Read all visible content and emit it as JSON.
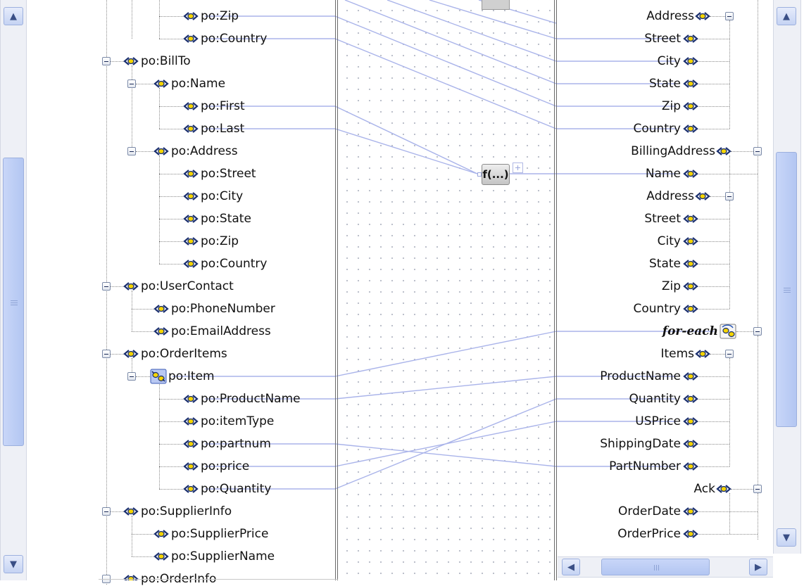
{
  "source_tree": [
    {
      "kind": "elem",
      "label": "po:Zip",
      "link": true
    },
    {
      "kind": "elem",
      "label": "po:Country",
      "link": true
    },
    {
      "kind": "node",
      "label": "po:BillTo",
      "expanded": true
    },
    {
      "kind": "node",
      "label": "po:Name",
      "expanded": true
    },
    {
      "kind": "elem",
      "label": "po:First",
      "link": true
    },
    {
      "kind": "elem",
      "label": "po:Last",
      "link": true
    },
    {
      "kind": "node",
      "label": "po:Address",
      "expanded": true
    },
    {
      "kind": "elem",
      "label": "po:Street",
      "link": false
    },
    {
      "kind": "elem",
      "label": "po:City",
      "link": false
    },
    {
      "kind": "elem",
      "label": "po:State",
      "link": false
    },
    {
      "kind": "elem",
      "label": "po:Zip",
      "link": false
    },
    {
      "kind": "elem",
      "label": "po:Country",
      "link": false
    },
    {
      "kind": "node",
      "label": "po:UserContact",
      "expanded": true
    },
    {
      "kind": "elem",
      "label": "po:PhoneNumber",
      "link": false
    },
    {
      "kind": "elem",
      "label": "po:EmailAddress",
      "link": false
    },
    {
      "kind": "node",
      "label": "po:OrderItems",
      "expanded": true
    },
    {
      "kind": "repeat",
      "label": "po:Item",
      "expanded": true,
      "link": true
    },
    {
      "kind": "elem",
      "label": "po:ProductName",
      "link": true
    },
    {
      "kind": "elem",
      "label": "po:itemType",
      "link": false
    },
    {
      "kind": "elem",
      "label": "po:partnum",
      "link": true
    },
    {
      "kind": "elem",
      "label": "po:price",
      "link": true
    },
    {
      "kind": "elem",
      "label": "po:Quantity",
      "link": true
    },
    {
      "kind": "node",
      "label": "po:SupplierInfo",
      "expanded": true
    },
    {
      "kind": "elem",
      "label": "po:SupplierPrice",
      "link": false
    },
    {
      "kind": "elem",
      "label": "po:SupplierName",
      "link": false
    },
    {
      "kind": "node",
      "label": "po:OrderInfo",
      "expanded": true
    }
  ],
  "target_tree": [
    {
      "kind": "node",
      "label": "Address",
      "link": false
    },
    {
      "kind": "elem",
      "label": "Street",
      "link": true
    },
    {
      "kind": "elem",
      "label": "City",
      "link": true
    },
    {
      "kind": "elem",
      "label": "State",
      "link": true
    },
    {
      "kind": "elem",
      "label": "Zip",
      "link": true
    },
    {
      "kind": "elem",
      "label": "Country",
      "link": true
    },
    {
      "kind": "node",
      "label": "BillingAddress",
      "link": false
    },
    {
      "kind": "elem",
      "label": "Name",
      "link": true
    },
    {
      "kind": "node",
      "label": "Address",
      "link": false
    },
    {
      "kind": "elem",
      "label": "Street",
      "link": false
    },
    {
      "kind": "elem",
      "label": "City",
      "link": false
    },
    {
      "kind": "elem",
      "label": "State",
      "link": false
    },
    {
      "kind": "elem",
      "label": "Zip",
      "link": false
    },
    {
      "kind": "elem",
      "label": "Country",
      "link": false
    },
    {
      "kind": "foreach",
      "label": "for-each",
      "link": true
    },
    {
      "kind": "node",
      "label": "Items",
      "link": false
    },
    {
      "kind": "elem",
      "label": "ProductName",
      "link": true
    },
    {
      "kind": "elem",
      "label": "Quantity",
      "link": true
    },
    {
      "kind": "elem",
      "label": "USPrice",
      "link": true
    },
    {
      "kind": "elem",
      "label": "ShippingDate",
      "link": false
    },
    {
      "kind": "elem",
      "label": "PartNumber",
      "link": true
    },
    {
      "kind": "node",
      "label": "Ack",
      "link": false
    },
    {
      "kind": "elem",
      "label": "OrderDate",
      "link": false
    },
    {
      "kind": "elem",
      "label": "OrderPrice",
      "link": false
    }
  ],
  "function_box": {
    "label": "f(...)"
  },
  "scrollbars": {
    "left_vertical": {
      "position": 0.55,
      "visible_fraction": 0.55
    },
    "right_vertical": {
      "position": 0.55,
      "visible_fraction": 0.55
    },
    "right_horizontal": {
      "position": 0.2,
      "visible_fraction": 0.4
    }
  },
  "colors": {
    "connector": "#aab4ea",
    "tree_line": "#8a8a8a",
    "element_icon_fill": "#f5d400",
    "element_icon_border": "#1a2f6e",
    "divider": "#6a6a6a",
    "grid_dot": "#b8bcc8",
    "scroll_accent": "#b3c6f2"
  }
}
